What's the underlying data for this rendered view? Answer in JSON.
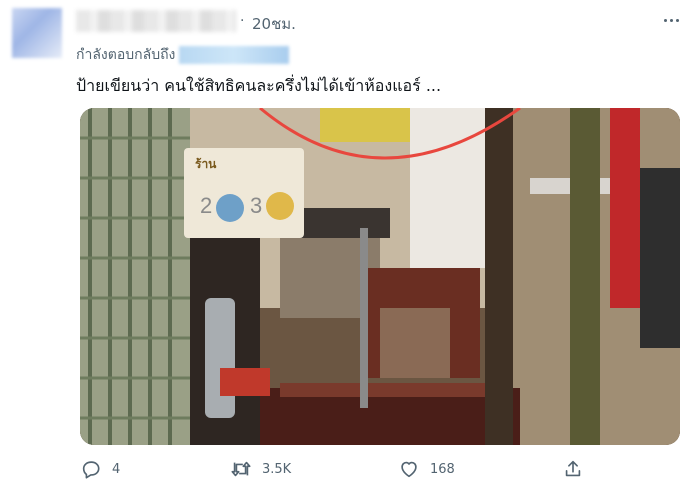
{
  "tweet": {
    "time": "20ชม.",
    "reply_label": "กำลังตอบกลับถึง",
    "text": "ป้ายเขียนว่า คนใช้สิทธิคนละครึ่งไม่ได้เข้าห้องแอร์ ..."
  },
  "media": {
    "sign_numbers": [
      "2",
      "3"
    ]
  },
  "actions": {
    "replies": "4",
    "retweets": "3.5K",
    "likes": "168"
  },
  "icons": {
    "more": "more-horizontal-icon",
    "reply": "reply-icon",
    "retweet": "retweet-icon",
    "like": "heart-icon",
    "share": "share-icon"
  },
  "colors": {
    "text_secondary": "#536471",
    "text_primary": "#0f1419",
    "annotation_circle": "#e8473e"
  }
}
